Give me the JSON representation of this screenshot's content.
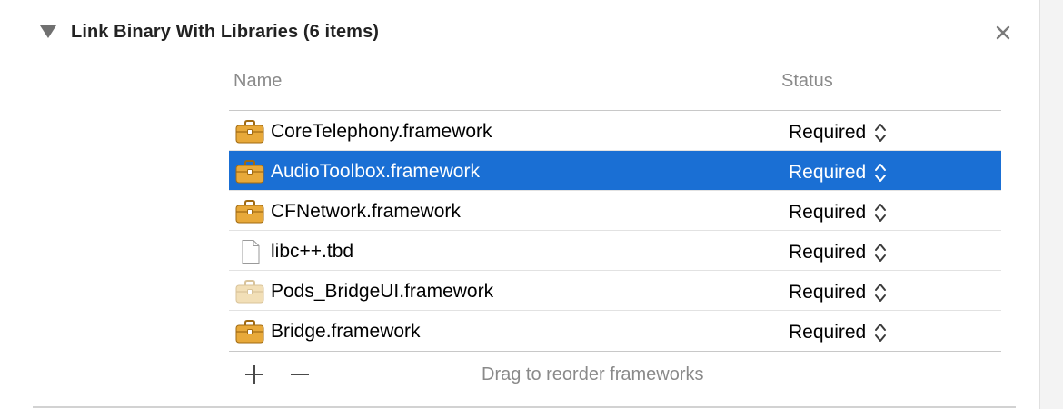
{
  "section": {
    "title": "Link Binary With Libraries (6 items)"
  },
  "table": {
    "columns": {
      "name": "Name",
      "status": "Status"
    },
    "rows": [
      {
        "name": "CoreTelephony.framework",
        "status": "Required",
        "icon": "toolbox-icon",
        "selected": false
      },
      {
        "name": "AudioToolbox.framework",
        "status": "Required",
        "icon": "toolbox-icon",
        "selected": true
      },
      {
        "name": "CFNetwork.framework",
        "status": "Required",
        "icon": "toolbox-icon",
        "selected": false
      },
      {
        "name": "libc++.tbd",
        "status": "Required",
        "icon": "document-icon",
        "selected": false
      },
      {
        "name": "Pods_BridgeUI.framework",
        "status": "Required",
        "icon": "toolbox-faded-icon",
        "selected": false
      },
      {
        "name": "Bridge.framework",
        "status": "Required",
        "icon": "toolbox-icon",
        "selected": false
      }
    ]
  },
  "footer": {
    "add_label": "+",
    "remove_label": "−",
    "hint": "Drag to reorder frameworks"
  },
  "colors": {
    "selection": "#1a6fd4",
    "toolbox_body": "#e8a93a",
    "toolbox_faded": "#f2dfb7"
  }
}
